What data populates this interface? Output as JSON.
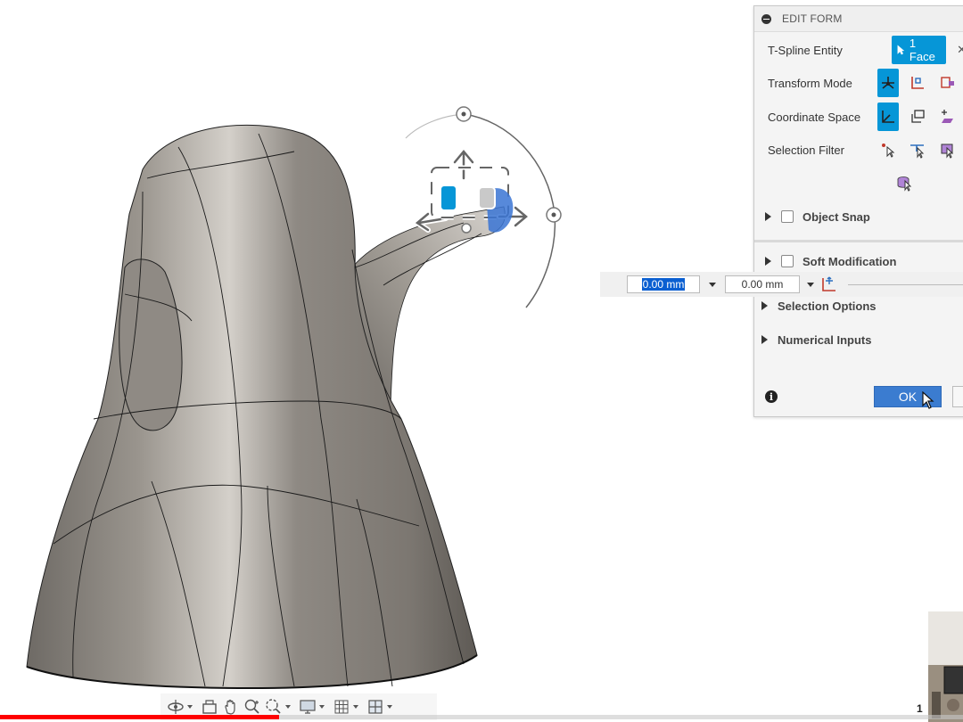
{
  "panel": {
    "title": "EDIT FORM",
    "rows": {
      "tspline_entity": {
        "label": "T-Spline Entity",
        "selection": "1 Face"
      },
      "transform_mode": {
        "label": "Transform Mode"
      },
      "coordinate_space": {
        "label": "Coordinate Space"
      },
      "selection_filter": {
        "label": "Selection Filter"
      }
    },
    "sections": {
      "object_snap": "Object Snap",
      "soft_modification": "Soft Modification",
      "selection_options": "Selection Options",
      "numerical_inputs": "Numerical Inputs"
    },
    "ok_label": "OK"
  },
  "numeric_inputs": {
    "first_value": "0.00 mm",
    "second_value": "0.00 mm"
  },
  "video": {
    "progress_fraction": 0.29
  },
  "colors": {
    "accent": "#0696d7",
    "ok_button": "#3b7cd0",
    "progress": "#ff0000",
    "model_surface": "#8a857f"
  },
  "icons": {
    "collapse": "minus-circle-icon",
    "info": "info-icon",
    "orbit": "orbit-icon",
    "pan": "pan-hand-icon",
    "zoom": "zoom-icon"
  }
}
